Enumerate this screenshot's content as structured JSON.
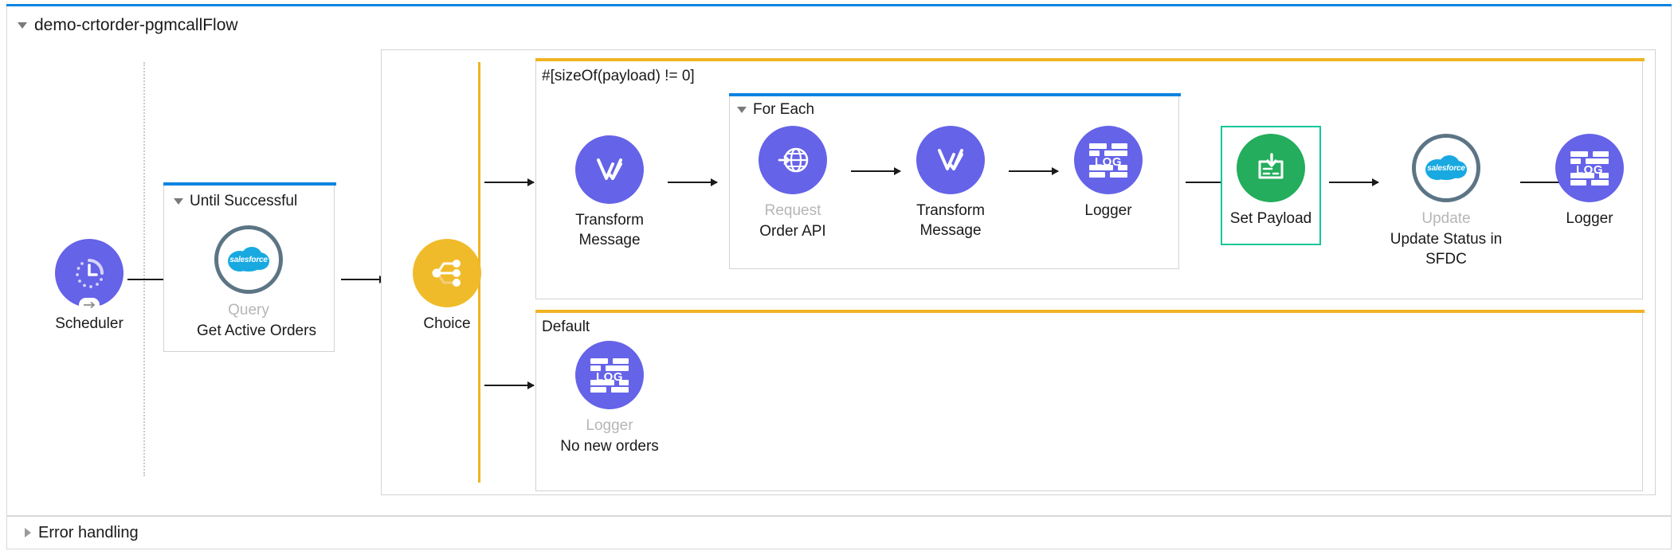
{
  "flow": {
    "title": "demo-crtorder-pgmcallFlow",
    "expander_icon": "triangle-down-icon",
    "accent_color": "#0b84e0"
  },
  "error_handling": {
    "label": "Error handling",
    "expander_icon": "triangle-right-icon"
  },
  "nodes": {
    "scheduler": {
      "label": "Scheduler",
      "icon": "clock-icon",
      "color": "#6563e8"
    },
    "salesforce_query": {
      "type_label": "Query",
      "name_label": "Get Active Orders",
      "icon": "salesforce-cloud-icon"
    },
    "choice": {
      "label": "Choice",
      "icon": "choice-branch-icon",
      "color": "#f0bb2b"
    },
    "transform_1": {
      "label_line1": "Transform",
      "label_line2": "Message",
      "icon": "transform-message-icon",
      "color": "#6563e8"
    },
    "http_request": {
      "type_label": "Request",
      "name_label": "Order API",
      "icon": "globe-icon",
      "color": "#6563e8"
    },
    "transform_2": {
      "label_line1": "Transform",
      "label_line2": "Message",
      "icon": "transform-message-icon",
      "color": "#6563e8"
    },
    "logger_foreach": {
      "label": "Logger",
      "icon": "log-icon",
      "color": "#6563e8"
    },
    "set_payload": {
      "label": "Set Payload",
      "icon": "set-payload-icon",
      "color": "#23ad5c",
      "selected_border": "#16c79a"
    },
    "salesforce_update": {
      "type_label": "Update",
      "name_line1": "Update Status in",
      "name_line2": "SFDC",
      "icon": "salesforce-cloud-icon"
    },
    "logger_end": {
      "label": "Logger",
      "icon": "log-icon",
      "color": "#6563e8"
    },
    "logger_default": {
      "type_label": "Logger",
      "name_label": "No new orders",
      "icon": "log-icon",
      "color": "#6563e8"
    }
  },
  "scopes": {
    "until_successful": {
      "label": "Until Successful",
      "accent_color": "#0b84e0",
      "expander_icon": "triangle-down-icon"
    },
    "for_each": {
      "label": "For Each",
      "accent_color": "#0b84e0",
      "expander_icon": "triangle-down-icon"
    },
    "choice_when": {
      "label": "#[sizeOf(payload) != 0]",
      "accent_color": "#f0b323"
    },
    "choice_default": {
      "label": "Default",
      "accent_color": "#f0b323"
    }
  },
  "salesforce_wordmark": "salesforce"
}
